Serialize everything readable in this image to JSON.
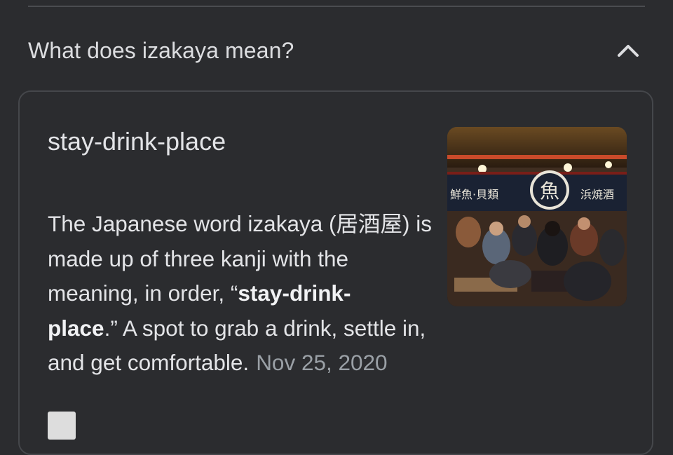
{
  "faq": {
    "question": "What does izakaya mean?",
    "expanded_icon": "chevron-up-icon"
  },
  "answer": {
    "title": "stay-drink-place",
    "body_part1": "The Japanese word izakaya (居酒屋) is made up of three kanji with the meaning, in order, “",
    "body_bold1": "stay-drink-",
    "body_bold2": "place",
    "body_part2": ".” A spot to grab a drink, settle in, and get comfortable.",
    "date": "Nov 25, 2020",
    "image_icon": "izakaya-photo",
    "banner_text_left": "鮮魚·貝類",
    "banner_logo": "魚",
    "banner_text_right": "浜焼酒"
  },
  "colors": {
    "background": "#2b2c2f",
    "text": "#e3e4e7",
    "muted": "#9aa0a6",
    "border": "#45474b"
  }
}
